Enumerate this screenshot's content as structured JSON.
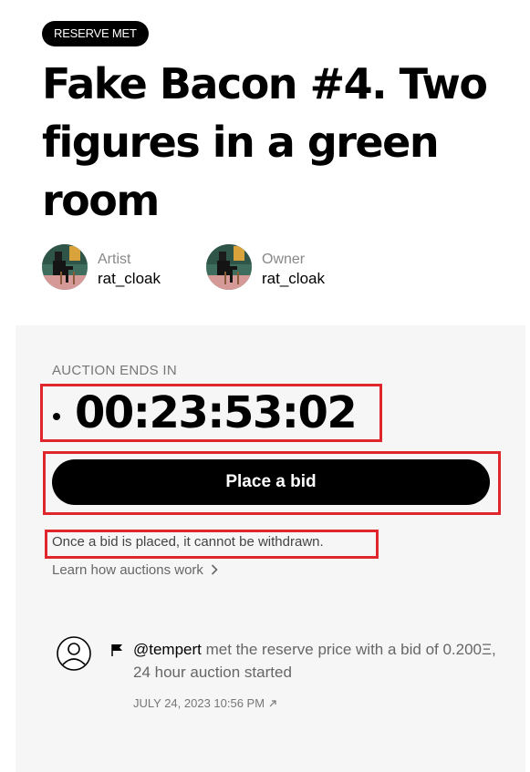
{
  "badge": "RESERVE MET",
  "title": "Fake Bacon #4. Two figures in a green room",
  "artist": {
    "role": "Artist",
    "name": "rat_cloak"
  },
  "owner": {
    "role": "Owner",
    "name": "rat_cloak"
  },
  "auction": {
    "ends_label": "AUCTION ENDS IN",
    "countdown": "00:23:53:02",
    "bid_button": "Place a bid",
    "notice": "Once a bid is placed, it cannot be withdrawn.",
    "learn_link": "Learn how auctions work"
  },
  "history": [
    {
      "user": "@tempert",
      "message": "met the reserve price with a bid of 0.200Ξ, 24 hour auction started",
      "date": "JULY 24, 2023 10:56 PM"
    }
  ],
  "icons": {
    "avatar": "artwork-avatar",
    "event_user": "user-circle-icon",
    "event_flag": "flag-icon",
    "learn_chevron": "chevron-right-icon",
    "date_link": "external-link-arrow-icon"
  },
  "colors": {
    "highlight": "#e0262d",
    "panel_bg": "#f6f6f6",
    "button_bg": "#000000"
  }
}
